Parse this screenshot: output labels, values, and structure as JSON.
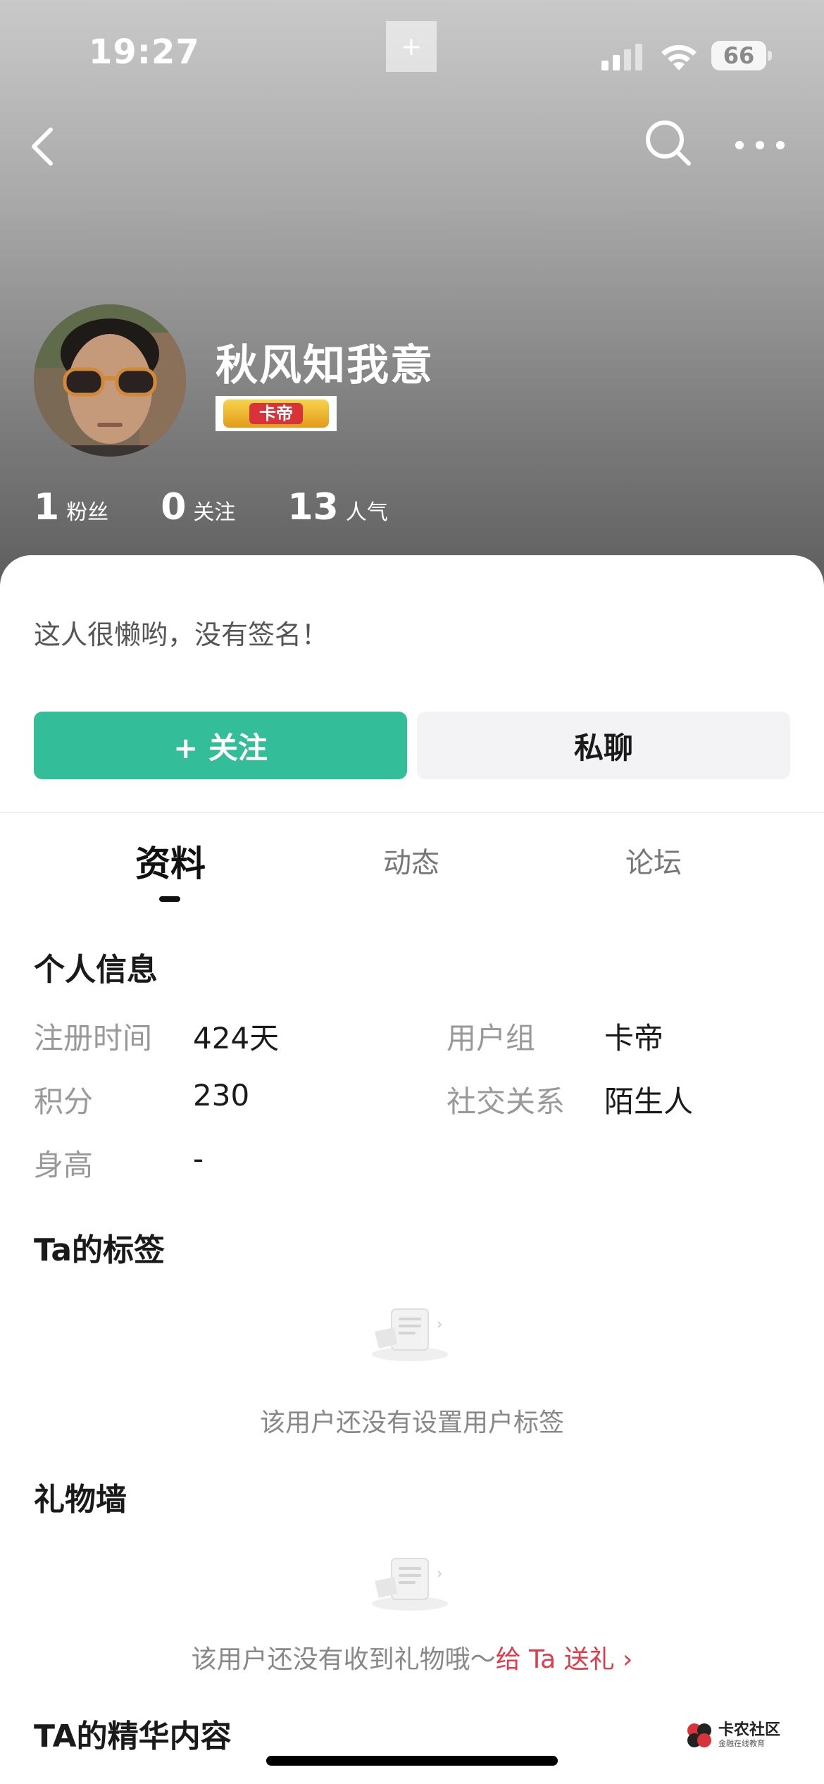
{
  "status_bar": {
    "time": "19:27",
    "plus": "+",
    "battery": "66"
  },
  "profile": {
    "username": "秋风知我意",
    "badge": "卡帝",
    "stats": [
      {
        "value": "1",
        "label": "粉丝"
      },
      {
        "value": "0",
        "label": "关注"
      },
      {
        "value": "13",
        "label": "人气"
      }
    ],
    "signature": "这人很懒哟，没有签名！"
  },
  "actions": {
    "follow": "+ 关注",
    "chat": "私聊"
  },
  "tabs": [
    {
      "label": "资料",
      "active": true
    },
    {
      "label": "动态",
      "active": false
    },
    {
      "label": "论坛",
      "active": false
    }
  ],
  "personal_info": {
    "title": "个人信息",
    "rows": [
      {
        "label": "注册时间",
        "value": "424天"
      },
      {
        "label": "用户组",
        "value": "卡帝"
      },
      {
        "label": "积分",
        "value": "230"
      },
      {
        "label": "社交关系",
        "value": "陌生人"
      },
      {
        "label": "身高",
        "value": "-"
      }
    ]
  },
  "tags": {
    "title": "Ta的标签",
    "empty_text": "该用户还没有设置用户标签"
  },
  "gifts": {
    "title": "礼物墙",
    "empty_text": "该用户还没有收到礼物哦～",
    "link": "给 Ta 送礼 ›"
  },
  "featured": {
    "title": "TA的精华内容"
  },
  "watermark": {
    "title": "卡农社区",
    "subtitle": "金融在线教育"
  },
  "colors": {
    "accent": "#33bd98",
    "link": "#e33a4a",
    "header_top": "#c9c9c9",
    "header_bottom": "#5e5e5e"
  }
}
